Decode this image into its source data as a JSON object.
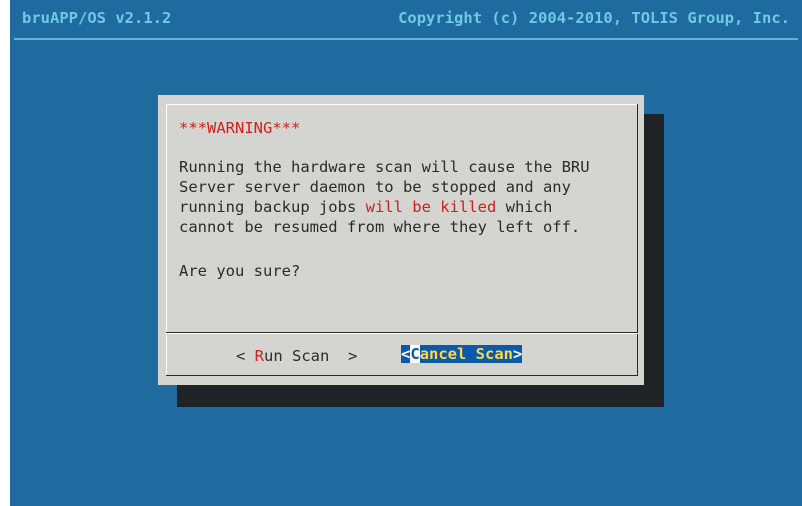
{
  "header": {
    "app_title": "bruAPP/OS v2.1.2",
    "copyright": "Copyright (c) 2004-2010, TOLIS Group, Inc."
  },
  "dialog": {
    "warning_title": "***WARNING***",
    "body_line1": "Running the hardware scan will cause the BRU",
    "body_line2": "Server server daemon to be stopped and any",
    "body_line3_pre": "running backup jobs ",
    "body_line3_red": "will be killed",
    "body_line3_post": " which",
    "body_line4": "cannot be resumed from where they left off.",
    "question": "Are you sure?"
  },
  "buttons": {
    "run": {
      "left": "< ",
      "hotkey": "R",
      "rest": "un Scan",
      "right": "  >"
    },
    "cancel": {
      "left": "<",
      "hotkey": "C",
      "rest": "ancel Scan",
      "right": ">"
    }
  },
  "colors": {
    "background": "#1f6a9e",
    "dialog": "#d4d4d0",
    "shadow": "#1f2326",
    "header_text": "#6ec8e6",
    "warning_red": "#cf1f1f",
    "selected_button_bg": "#0b59a8",
    "selected_button_text": "#ffd84a"
  }
}
